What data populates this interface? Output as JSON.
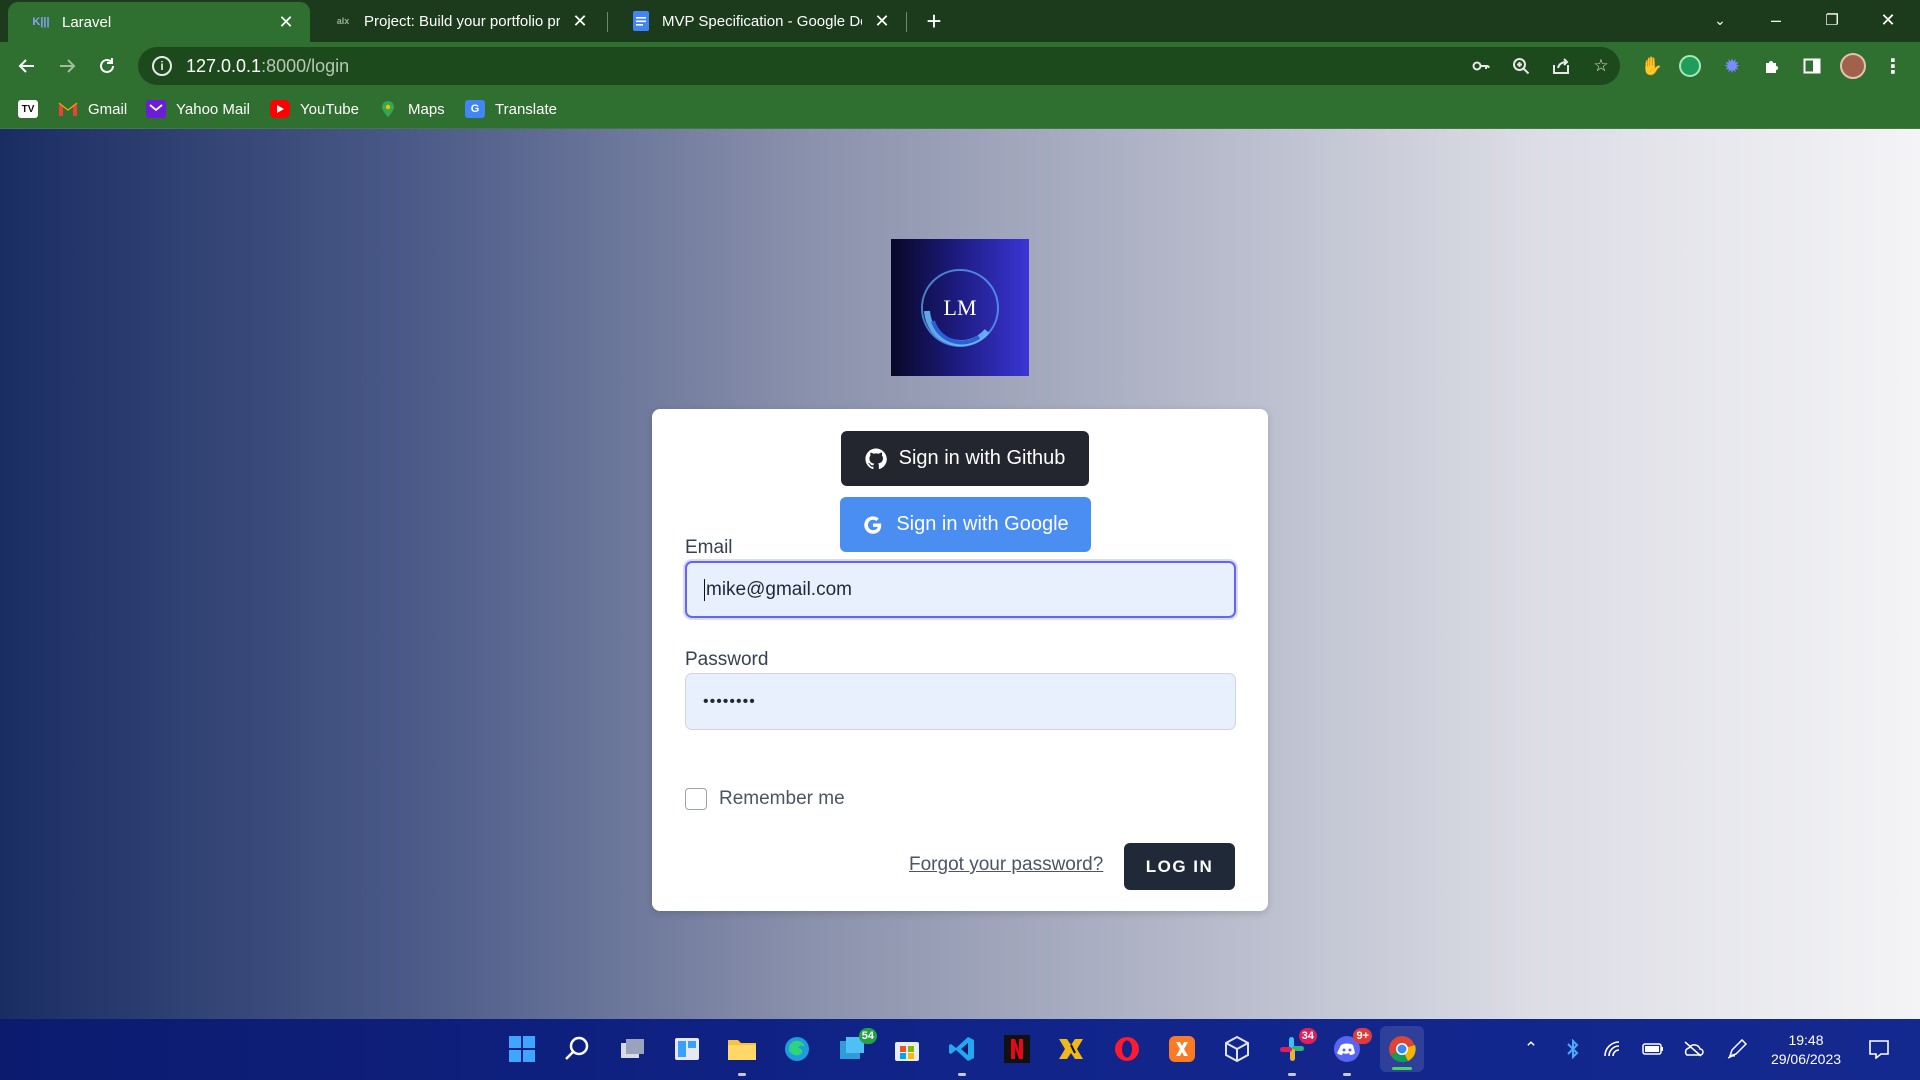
{
  "browser": {
    "tabs": [
      {
        "title": "Laravel",
        "favicon": "laravel-icon",
        "active": true
      },
      {
        "title": "Project: Build your portfolio proje",
        "favicon": "alx-icon",
        "active": false
      },
      {
        "title": "MVP Specification - Google Docs",
        "favicon": "google-docs-icon",
        "active": false
      }
    ],
    "url_host": "127.0.0.1",
    "url_path": ":8000/login",
    "bookmarks": [
      {
        "label": "",
        "icon": "tradingview-icon"
      },
      {
        "label": "Gmail",
        "icon": "gmail-icon"
      },
      {
        "label": "Yahoo Mail",
        "icon": "yahoo-mail-icon"
      },
      {
        "label": "YouTube",
        "icon": "youtube-icon"
      },
      {
        "label": "Maps",
        "icon": "maps-icon"
      },
      {
        "label": "Translate",
        "icon": "translate-icon"
      }
    ]
  },
  "login": {
    "github_button": "Sign in with Github",
    "google_button": "Sign in with Google",
    "email_label": "Email",
    "email_value": "mike@gmail.com",
    "password_label": "Password",
    "password_value": "••••••••",
    "remember_label": "Remember me",
    "remember_checked": false,
    "forgot_link": "Forgot your password?",
    "login_button": "LOG IN"
  },
  "taskbar": {
    "badges": {
      "whatsapp": "54",
      "slack": "34",
      "discord": "9+"
    },
    "time": "19:48",
    "date": "29/06/2023"
  },
  "colors": {
    "chrome_frame": "#1c3b1c",
    "chrome_toolbar": "#2f6f2f",
    "github_button": "#23262e",
    "google_button": "#4b8ef2",
    "login_button": "#1f2937",
    "focus_ring": "#6366f1"
  }
}
